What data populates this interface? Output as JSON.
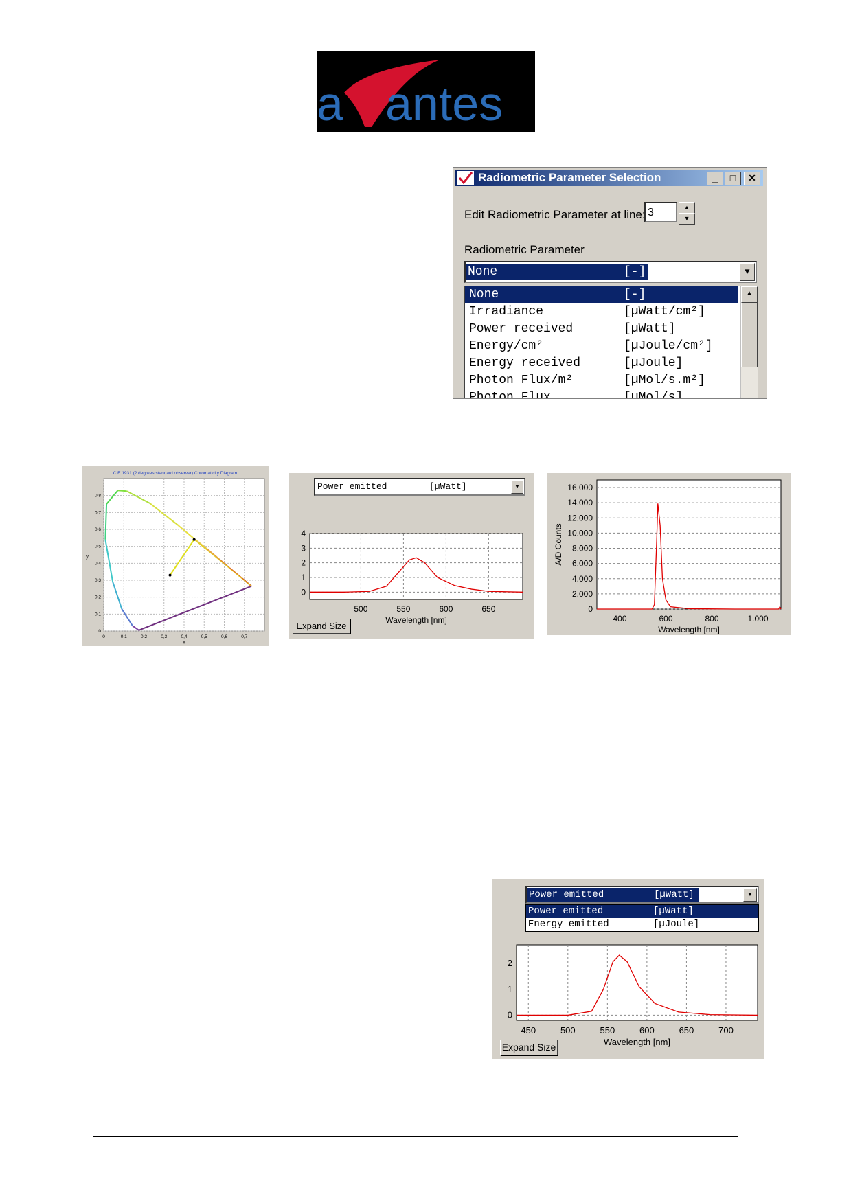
{
  "logo": {
    "text": "avantes"
  },
  "dialog": {
    "title": "Radiometric Parameter Selection",
    "edit_label": "Edit Radiometric Parameter at line:",
    "line_value": "3",
    "param_label": "Radiometric Parameter",
    "selected": {
      "name": "None",
      "unit": "[-]"
    },
    "items": [
      {
        "name": "None",
        "unit": "[-]"
      },
      {
        "name": "Irradiance",
        "unit": "[µWatt/cm²]"
      },
      {
        "name": "Power received",
        "unit": "[µWatt]"
      },
      {
        "name": "Energy/cm²",
        "unit": "[µJoule/cm²]"
      },
      {
        "name": "Energy received",
        "unit": "[µJoule]"
      },
      {
        "name": "Photon Flux/m²",
        "unit": "[µMol/s.m²]"
      },
      {
        "name": "Photon Flux",
        "unit": "[µMol/s]"
      }
    ]
  },
  "cie": {
    "title": "CIE 1931 (2 degrees standard observer) Chromaticity Diagram",
    "xlabel": "x",
    "ylabel": "y"
  },
  "power_panel": {
    "combo_name": "Power emitted",
    "combo_unit": "[µWatt]",
    "button": "Expand Size"
  },
  "drop_panel": {
    "combo_name": "Power emitted",
    "combo_unit": "[µWatt]",
    "options": [
      {
        "name": "Power emitted",
        "unit": "[µWatt]"
      },
      {
        "name": "Energy emitted",
        "unit": "[µJoule]"
      }
    ],
    "button": "Expand Size"
  },
  "chart_data": [
    {
      "type": "scatter",
      "title": "CIE 1931 (2 degrees standard observer) Chromaticity Diagram",
      "xlabel": "x",
      "ylabel": "y",
      "xlim": [
        0,
        0.8
      ],
      "ylim": [
        0,
        0.9
      ],
      "x_ticks": [
        "0",
        "0,1",
        "0,2",
        "0,3",
        "0,4",
        "0,5",
        "0,6",
        "0,7"
      ],
      "y_ticks": [
        "0",
        "0,1",
        "0,2",
        "0,3",
        "0,4",
        "0,5",
        "0,6",
        "0,7",
        "0,8"
      ],
      "series": [
        {
          "name": "",
          "x": [
            0.33,
            0.45
          ],
          "y": [
            0.33,
            0.54
          ]
        }
      ]
    },
    {
      "type": "line",
      "xlabel": "Wavelength [nm]",
      "ylabel": "",
      "xlim": [
        440,
        690
      ],
      "ylim": [
        -0.5,
        4
      ],
      "x_ticks": [
        "500",
        "550",
        "600",
        "650"
      ],
      "y_ticks": [
        "0",
        "1",
        "2",
        "3",
        "4"
      ],
      "series": [
        {
          "name": "",
          "x": [
            440,
            480,
            510,
            530,
            545,
            557,
            565,
            575,
            590,
            610,
            630,
            650,
            690
          ],
          "y": [
            0,
            0,
            0.05,
            0.4,
            1.4,
            2.2,
            2.35,
            2.0,
            1.0,
            0.45,
            0.2,
            0.05,
            0
          ]
        }
      ]
    },
    {
      "type": "line",
      "xlabel": "Wavelength [nm]",
      "ylabel": "A/D Counts",
      "xlim": [
        300,
        1100
      ],
      "ylim": [
        0,
        17000
      ],
      "x_ticks": [
        "400",
        "600",
        "800",
        "1.000"
      ],
      "y_ticks": [
        "0",
        "2.000",
        "4.000",
        "6.000",
        "8.000",
        "10.000",
        "12.000",
        "14.000",
        "16.000"
      ],
      "series": [
        {
          "name": "",
          "x": [
            300,
            540,
            550,
            560,
            565,
            575,
            585,
            600,
            620,
            700,
            900,
            1090,
            1095,
            1100
          ],
          "y": [
            0,
            0,
            600,
            9000,
            13900,
            11000,
            4000,
            1200,
            300,
            50,
            0,
            0,
            300,
            0
          ]
        }
      ]
    },
    {
      "type": "line",
      "xlabel": "Wavelength [nm]",
      "ylabel": "",
      "xlim": [
        435,
        740
      ],
      "ylim": [
        -0.2,
        2.7
      ],
      "x_ticks": [
        "450",
        "500",
        "550",
        "600",
        "650",
        "700"
      ],
      "y_ticks": [
        "0",
        "1",
        "2"
      ],
      "series": [
        {
          "name": "",
          "x": [
            435,
            500,
            530,
            545,
            557,
            565,
            575,
            590,
            610,
            640,
            680,
            740
          ],
          "y": [
            0,
            0,
            0.15,
            1.0,
            2.05,
            2.3,
            2.05,
            1.1,
            0.45,
            0.12,
            0.02,
            0
          ]
        }
      ]
    }
  ]
}
